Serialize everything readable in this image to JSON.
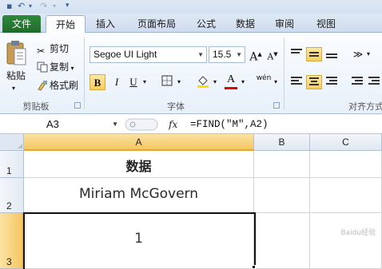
{
  "ribbon_tabs": [
    "文件",
    "开始",
    "插入",
    "页面布局",
    "公式",
    "数据",
    "审阅",
    "视图"
  ],
  "clipboard": {
    "paste": "粘贴",
    "cut": "剪切",
    "copy": "复制",
    "format_painter": "格式刷",
    "group": "剪贴板"
  },
  "font": {
    "name": "Segoe UI Light",
    "size": "15.5",
    "grow": "A",
    "shrink": "A",
    "bold": "B",
    "italic": "I",
    "underline": "U",
    "font_color_letter": "A",
    "phonetic": "wén",
    "group": "字体"
  },
  "alignment": {
    "group": "对齐方式"
  },
  "formula_bar": {
    "name_box": "A3",
    "fx": "fx",
    "formula": "=FIND(\"M\",A2)"
  },
  "columns": [
    "A",
    "B",
    "C"
  ],
  "rows": [
    "1",
    "2",
    "3"
  ],
  "cells": {
    "A1": "数据",
    "A2": "Miriam McGovern",
    "A3": "1"
  },
  "selection": "A3",
  "watermark": "Baidu经验",
  "colors": {
    "file_tab": "#1e6b2a",
    "selection_header": "#f5c662"
  }
}
